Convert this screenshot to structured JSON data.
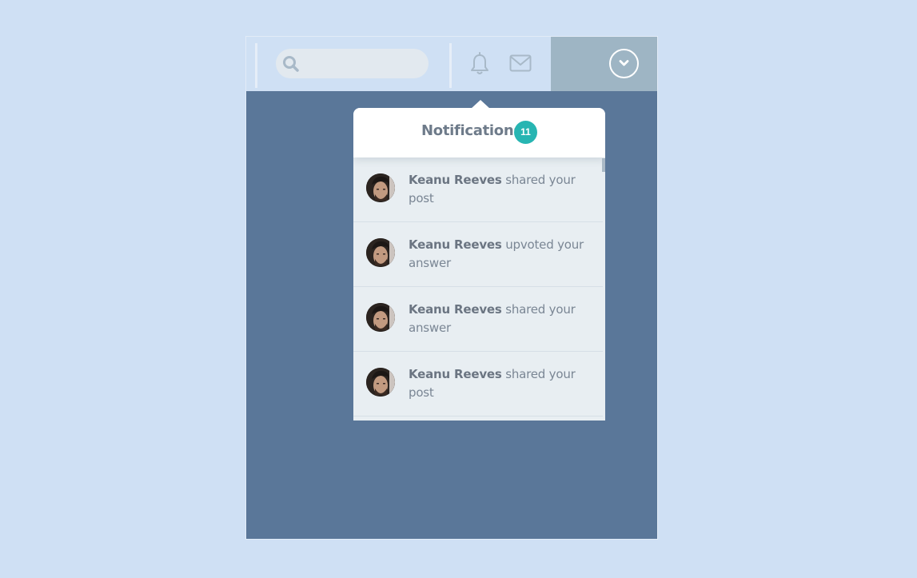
{
  "topbar": {
    "search": {
      "placeholder": "",
      "icon": "search-icon"
    },
    "icons": [
      "bell-icon",
      "mail-icon",
      "chevron-down-icon"
    ]
  },
  "notifications": {
    "title": "Notifications",
    "count": "11",
    "items": [
      {
        "name": "Keanu Reeves",
        "action": "shared your post"
      },
      {
        "name": "Keanu Reeves",
        "action": "upvoted your answer"
      },
      {
        "name": "Keanu Reeves",
        "action": "shared your answer"
      },
      {
        "name": "Keanu Reeves",
        "action": "shared your post"
      }
    ]
  },
  "colors": {
    "page_bg": "#cfe0f4",
    "panel_bg": "#5a7799",
    "badge": "#27b5b2",
    "account_bg": "#9eb5c4"
  }
}
